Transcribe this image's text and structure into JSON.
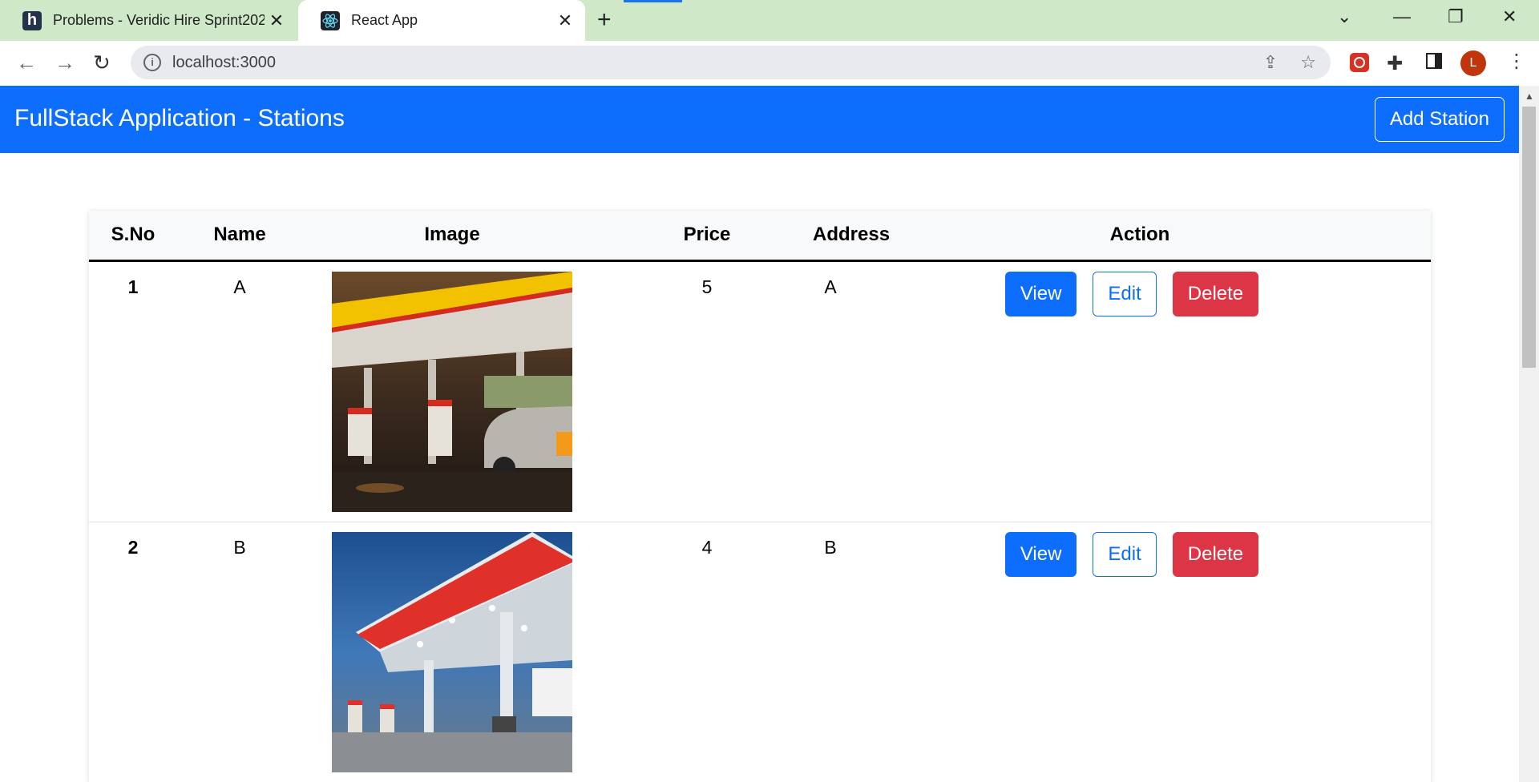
{
  "browser": {
    "tabs": [
      {
        "title": "Problems - Veridic Hire Sprint202",
        "favicon": "h",
        "active": false
      },
      {
        "title": "React App",
        "favicon": "react-icon",
        "active": true
      }
    ],
    "url": "localhost:3000",
    "profile_initial": "L"
  },
  "navbar": {
    "brand": "FullStack Application - Stations",
    "add_button": "Add Station",
    "color": "#0d6efd"
  },
  "table": {
    "headers": [
      "S.No",
      "Name",
      "Image",
      "Price",
      "Address",
      "Action"
    ],
    "rows": [
      {
        "sno": "1",
        "name": "A",
        "image": "gas-station-photo-daytime",
        "price": "5",
        "address": "A"
      },
      {
        "sno": "2",
        "name": "B",
        "image": "gas-station-photo-dusk",
        "price": "4",
        "address": "B"
      }
    ],
    "actions": {
      "view": "View",
      "edit": "Edit",
      "delete": "Delete"
    }
  }
}
